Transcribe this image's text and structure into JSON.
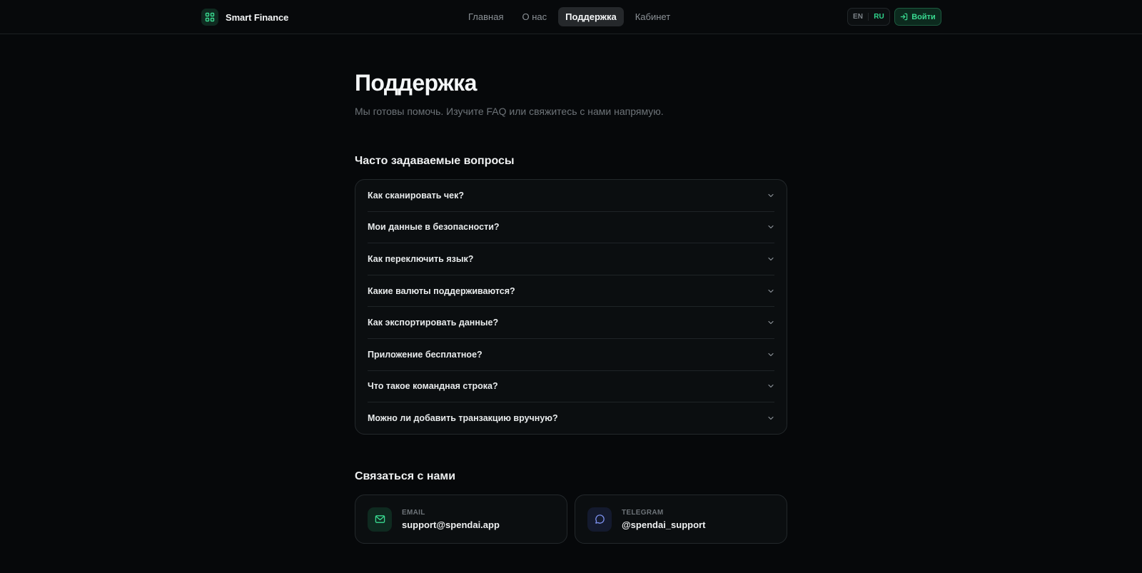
{
  "header": {
    "brand_name": "Smart Finance",
    "nav": [
      "Главная",
      "О нас",
      "Поддержка",
      "Кабинет"
    ],
    "active_nav": "Поддержка",
    "lang_en": "EN",
    "lang_ru": "RU",
    "login_label": "Войти"
  },
  "main": {
    "title": "Поддержка",
    "subtitle": "Мы готовы помочь. Изучите FAQ или свяжитесь с нами напрямую.",
    "faq_title": "Часто задаваемые вопросы",
    "faq": [
      "Как сканировать чек?",
      "Мои данные в безопасности?",
      "Как переключить язык?",
      "Какие валюты поддерживаются?",
      "Как экспортировать данные?",
      "Приложение бесплатное?",
      "Что такое командная строка?",
      "Можно ли добавить транзакцию вручную?"
    ],
    "contact_title": "Связаться с нами",
    "contacts": [
      {
        "label": "EMAIL",
        "value": "support@spendai.app",
        "icon": "mail-icon"
      },
      {
        "label": "TELEGRAM",
        "value": "@spendai_support",
        "icon": "chat-icon"
      }
    ]
  },
  "colors": {
    "background": "#06080a",
    "accent": "#2fd58c",
    "card": "#0b0e10"
  }
}
